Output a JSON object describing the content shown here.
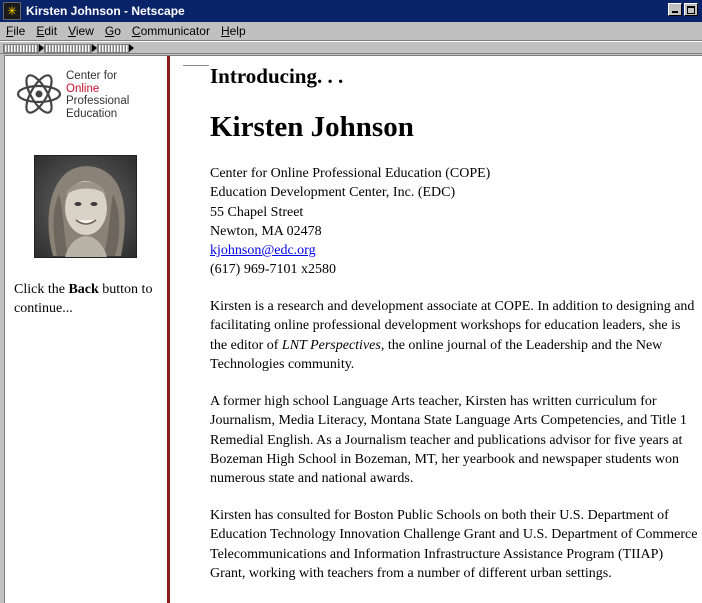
{
  "window": {
    "title": "Kirsten Johnson - Netscape",
    "icon": "netscape-icon"
  },
  "menu": [
    {
      "label": "File",
      "key": "F",
      "rest": "ile"
    },
    {
      "label": "Edit",
      "key": "E",
      "rest": "dit"
    },
    {
      "label": "View",
      "key": "V",
      "rest": "iew"
    },
    {
      "label": "Go",
      "key": "G",
      "rest": "o"
    },
    {
      "label": "Communicator",
      "key": "C",
      "rest": "ommunicator"
    },
    {
      "label": "Help",
      "key": "H",
      "rest": "elp"
    }
  ],
  "sidebar": {
    "logo": {
      "line1": "Center for",
      "line2": "Online",
      "line3": "Professional",
      "line4": "Education"
    },
    "note_prefix": "Click the ",
    "note_bold": "Back",
    "note_suffix": " button to continue..."
  },
  "main": {
    "intro": "Introducing. . .",
    "name": "Kirsten Johnson",
    "address": {
      "line1": "Center for Online Professional Education (COPE)",
      "line2": "Education Development Center, Inc. (EDC)",
      "line3": "55 Chapel Street",
      "line4": "Newton, MA  02478",
      "email": "kjohnson@edc.org",
      "phone": "(617) 969-7101 x2580"
    },
    "bio1_part1": "Kirsten is a research and development associate at COPE.  In addition to designing and facilitating online professional development workshops for education leaders, she is the editor of ",
    "bio1_italic": "LNT Perspectives",
    "bio1_part2": ", the online journal of the Leadership and the New Technologies community.",
    "bio2": "A former high school Language Arts teacher, Kirsten has written curriculum for Journalism, Media Literacy, Montana State Language Arts Competencies, and Title 1 Remedial English. As a Journalism teacher and publications advisor for five years at Bozeman High School in Bozeman, MT, her yearbook and newspaper students won numerous state and national awards.",
    "bio3": "Kirsten has consulted for Boston Public Schools on both their U.S. Department of Education Technology Innovation Challenge Grant and U.S. Department of Commerce Telecommunications and Information Infrastructure Assistance Program (TIIAP) Grant, working with teachers from a number of different urban settings."
  },
  "colors": {
    "titlebar": "#0a246a",
    "divider": "#8b1a1a",
    "link": "#0000ee",
    "logo_red": "#c8102e"
  }
}
